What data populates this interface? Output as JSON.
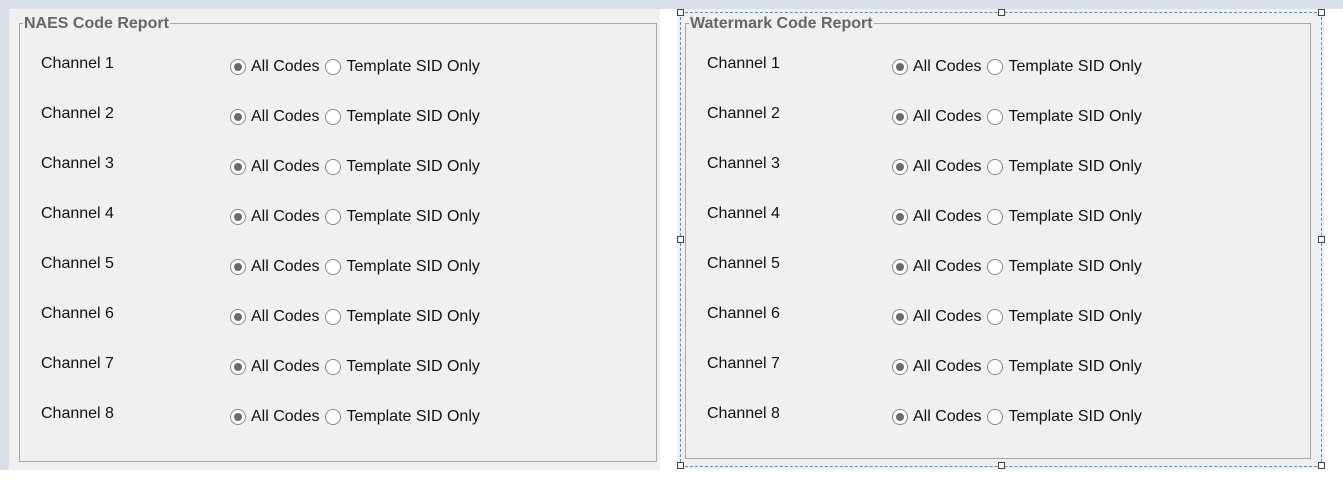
{
  "naes": {
    "title": "NAES Code Report",
    "rows": [
      {
        "label": "Channel 1",
        "opt1": "All Codes",
        "opt2": "Template SID Only",
        "selected": "All Codes"
      },
      {
        "label": "Channel 2",
        "opt1": "All Codes",
        "opt2": "Template SID Only",
        "selected": "All Codes"
      },
      {
        "label": "Channel 3",
        "opt1": "All Codes",
        "opt2": "Template SID Only",
        "selected": "All Codes"
      },
      {
        "label": "Channel 4",
        "opt1": "All Codes",
        "opt2": "Template SID Only",
        "selected": "All Codes"
      },
      {
        "label": "Channel 5",
        "opt1": "All Codes",
        "opt2": "Template SID Only",
        "selected": "All Codes"
      },
      {
        "label": "Channel 6",
        "opt1": "All Codes",
        "opt2": "Template SID Only",
        "selected": "All Codes"
      },
      {
        "label": "Channel 7",
        "opt1": "All Codes",
        "opt2": "Template SID Only",
        "selected": "All Codes"
      },
      {
        "label": "Channel 8",
        "opt1": "All Codes",
        "opt2": "Template SID Only",
        "selected": "All Codes"
      }
    ]
  },
  "watermark": {
    "title": "Watermark Code Report",
    "rows": [
      {
        "label": "Channel 1",
        "opt1": "All Codes",
        "opt2": "Template SID Only",
        "selected": "All Codes"
      },
      {
        "label": "Channel 2",
        "opt1": "All Codes",
        "opt2": "Template SID Only",
        "selected": "All Codes"
      },
      {
        "label": "Channel 3",
        "opt1": "All Codes",
        "opt2": "Template SID Only",
        "selected": "All Codes"
      },
      {
        "label": "Channel 4",
        "opt1": "All Codes",
        "opt2": "Template SID Only",
        "selected": "All Codes"
      },
      {
        "label": "Channel 5",
        "opt1": "All Codes",
        "opt2": "Template SID Only",
        "selected": "All Codes"
      },
      {
        "label": "Channel 6",
        "opt1": "All Codes",
        "opt2": "Template SID Only",
        "selected": "All Codes"
      },
      {
        "label": "Channel 7",
        "opt1": "All Codes",
        "opt2": "Template SID Only",
        "selected": "All Codes"
      },
      {
        "label": "Channel 8",
        "opt1": "All Codes",
        "opt2": "Template SID Only",
        "selected": "All Codes"
      }
    ]
  },
  "colors": {
    "panel_bg": "#f0f0f0",
    "legend_text": "#666666",
    "selection_border": "#4c8ed8"
  }
}
